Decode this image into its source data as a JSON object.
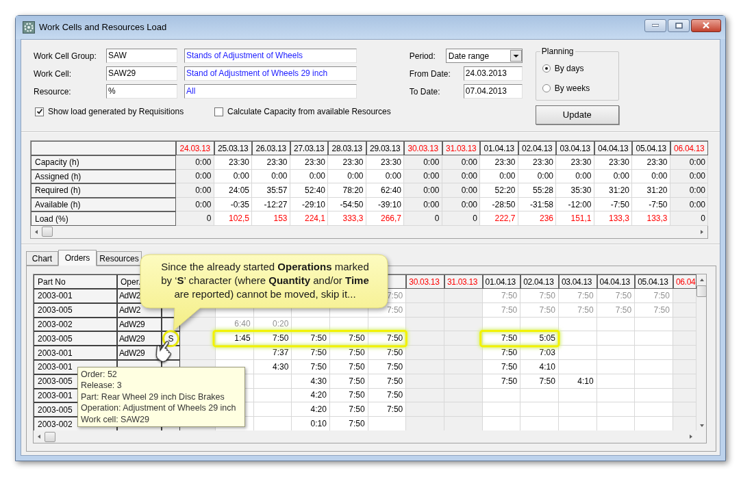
{
  "window": {
    "title": "Work Cells and Resources Load"
  },
  "filters": [
    {
      "label": "Work Cell Group:",
      "code": "SAW",
      "description": "Stands of Adjustment of Wheels"
    },
    {
      "label": "Work Cell:",
      "code": "SAW29",
      "description": "Stand of Adjustment of Wheels 29 inch"
    },
    {
      "label": "Resource:",
      "code": "%",
      "description": "All"
    }
  ],
  "options": [
    {
      "label": "Show load generated by Requisitions",
      "checked": true
    },
    {
      "label": "Calculate Capacity from available Resources",
      "checked": false
    }
  ],
  "period": {
    "label": "Period:",
    "value": "Date range"
  },
  "dates": [
    {
      "label": "From Date:",
      "value": "24.03.2013"
    },
    {
      "label": "To Date:",
      "value": "07.04.2013"
    }
  ],
  "planning": {
    "title": "Planning",
    "options": [
      {
        "label": "By days",
        "selected": true
      },
      {
        "label": "By weeks",
        "selected": false
      }
    ]
  },
  "update_button": "Update",
  "summary": {
    "columns": [
      {
        "label": "24.03.13",
        "weekend": true
      },
      {
        "label": "25.03.13",
        "weekend": false
      },
      {
        "label": "26.03.13",
        "weekend": false
      },
      {
        "label": "27.03.13",
        "weekend": false
      },
      {
        "label": "28.03.13",
        "weekend": false
      },
      {
        "label": "29.03.13",
        "weekend": false
      },
      {
        "label": "30.03.13",
        "weekend": true
      },
      {
        "label": "31.03.13",
        "weekend": true
      },
      {
        "label": "01.04.13",
        "weekend": false
      },
      {
        "label": "02.04.13",
        "weekend": false
      },
      {
        "label": "03.04.13",
        "weekend": false
      },
      {
        "label": "04.04.13",
        "weekend": false
      },
      {
        "label": "05.04.13",
        "weekend": false
      },
      {
        "label": "06.04.13",
        "weekend": true
      }
    ],
    "rows": [
      {
        "label": "Capacity (h)",
        "cells": [
          "0:00",
          "23:30",
          "23:30",
          "23:30",
          "23:30",
          "23:30",
          "0:00",
          "0:00",
          "23:30",
          "23:30",
          "23:30",
          "23:30",
          "23:30",
          "0:00"
        ]
      },
      {
        "label": "Assigned (h)",
        "cells": [
          "0:00",
          "0:00",
          "0:00",
          "0:00",
          "0:00",
          "0:00",
          "0:00",
          "0:00",
          "0:00",
          "0:00",
          "0:00",
          "0:00",
          "0:00",
          "0:00"
        ]
      },
      {
        "label": "Required (h)",
        "cells": [
          "0:00",
          "24:05",
          "35:57",
          "52:40",
          "78:20",
          "62:40",
          "0:00",
          "0:00",
          "52:20",
          "55:28",
          "35:30",
          "31:20",
          "31:20",
          "0:00"
        ]
      },
      {
        "label": "Available (h)",
        "cells": [
          "0:00",
          "-0:35",
          "-12:27",
          "-29:10",
          "-54:50",
          "-39:10",
          "0:00",
          "0:00",
          "-28:50",
          "-31:58",
          "-12:00",
          "-7:50",
          "-7:50",
          "0:00"
        ]
      },
      {
        "label": "Load (%)",
        "cells": [
          {
            "text": "0",
            "over": false
          },
          {
            "text": "102,5",
            "over": true
          },
          {
            "text": "153",
            "over": true
          },
          {
            "text": "224,1",
            "over": true
          },
          {
            "text": "333,3",
            "over": true
          },
          {
            "text": "266,7",
            "over": true
          },
          {
            "text": "0",
            "over": false
          },
          {
            "text": "0",
            "over": false
          },
          {
            "text": "222,7",
            "over": true
          },
          {
            "text": "236",
            "over": true
          },
          {
            "text": "151,1",
            "over": true
          },
          {
            "text": "133,3",
            "over": true
          },
          {
            "text": "133,3",
            "over": true
          },
          {
            "text": "0",
            "over": false
          }
        ]
      }
    ]
  },
  "tabs": [
    {
      "label": "Chart",
      "selected": false
    },
    {
      "label": "Orders",
      "selected": true
    },
    {
      "label": "Resources",
      "selected": false
    }
  ],
  "orders": {
    "columns": [
      "Part No",
      "Oper."
    ],
    "date_headers": [
      "30.03.13",
      "31.03.13",
      "01.04.13",
      "02.04.13",
      "03.04.13",
      "04.04.13",
      "05.04.13",
      "06.04"
    ],
    "rows": [
      {
        "part_no": "2003-001",
        "oper": "AdW2",
        "cells": [
          null,
          null,
          null,
          null,
          null,
          {
            "text": "7:50",
            "muted": true,
            "highlighted": false
          },
          null,
          null,
          {
            "text": "7:50",
            "muted": true,
            "highlighted": false
          },
          {
            "text": "7:50",
            "muted": true,
            "highlighted": false
          },
          {
            "text": "7:50",
            "muted": true,
            "highlighted": false
          },
          {
            "text": "7:50",
            "muted": true,
            "highlighted": false
          },
          {
            "text": "7:50",
            "muted": true,
            "highlighted": false
          },
          null
        ]
      },
      {
        "part_no": "2003-005",
        "oper": "AdW2",
        "cells": [
          null,
          null,
          null,
          null,
          null,
          {
            "text": "7:50",
            "muted": true,
            "highlighted": false
          },
          null,
          null,
          {
            "text": "7:50",
            "muted": true,
            "highlighted": false
          },
          {
            "text": "7:50",
            "muted": true,
            "highlighted": false
          },
          {
            "text": "7:50",
            "muted": true,
            "highlighted": false
          },
          {
            "text": "7:50",
            "muted": true,
            "highlighted": false
          },
          {
            "text": "7:50",
            "muted": true,
            "highlighted": false
          },
          null
        ]
      },
      {
        "part_no": "2003-002",
        "oper": "AdW29",
        "cells": [
          null,
          {
            "text": "6:40",
            "muted": true,
            "highlighted": false
          },
          {
            "text": "0:20",
            "muted": true,
            "highlighted": false
          },
          null,
          null,
          null,
          null,
          null,
          null,
          null,
          null,
          null,
          null,
          null
        ]
      },
      {
        "part_no": "2003-005",
        "oper": "AdW29",
        "status": "S",
        "cells": [
          null,
          {
            "text": "1:45",
            "muted": false,
            "highlighted": true
          },
          {
            "text": "7:50",
            "muted": false,
            "highlighted": true
          },
          {
            "text": "7:50",
            "muted": false,
            "highlighted": true
          },
          {
            "text": "7:50",
            "muted": false,
            "highlighted": true
          },
          {
            "text": "7:50",
            "muted": false,
            "highlighted": true
          },
          null,
          null,
          {
            "text": "7:50",
            "muted": false,
            "highlighted": true
          },
          {
            "text": "5:05",
            "muted": false,
            "highlighted": true
          },
          null,
          null,
          null,
          null
        ]
      },
      {
        "part_no": "2003-001",
        "oper": "AdW29",
        "cells": [
          null,
          null,
          {
            "text": "7:37",
            "muted": false,
            "highlighted": false
          },
          {
            "text": "7:50",
            "muted": false,
            "highlighted": false
          },
          {
            "text": "7:50",
            "muted": false,
            "highlighted": false
          },
          {
            "text": "7:50",
            "muted": false,
            "highlighted": false
          },
          null,
          null,
          {
            "text": "7:50",
            "muted": false,
            "highlighted": false
          },
          {
            "text": "7:03",
            "muted": false,
            "highlighted": false
          },
          null,
          null,
          null,
          null
        ]
      },
      {
        "part_no": "2003-001",
        "cells": [
          null,
          null,
          {
            "text": "4:30",
            "muted": false,
            "highlighted": false
          },
          {
            "text": "7:50",
            "muted": false,
            "highlighted": false
          },
          {
            "text": "7:50",
            "muted": false,
            "highlighted": false
          },
          {
            "text": "7:50",
            "muted": false,
            "highlighted": false
          },
          null,
          null,
          {
            "text": "7:50",
            "muted": false,
            "highlighted": false
          },
          {
            "text": "4:10",
            "muted": false,
            "highlighted": false
          },
          null,
          null,
          null,
          null
        ]
      },
      {
        "part_no": "2003-005",
        "cells": [
          null,
          null,
          null,
          {
            "text": "4:30",
            "muted": false,
            "highlighted": false
          },
          {
            "text": "7:50",
            "muted": false,
            "highlighted": false
          },
          {
            "text": "7:50",
            "muted": false,
            "highlighted": false
          },
          null,
          null,
          {
            "text": "7:50",
            "muted": false,
            "highlighted": false
          },
          {
            "text": "7:50",
            "muted": false,
            "highlighted": false
          },
          {
            "text": "4:10",
            "muted": false,
            "highlighted": false
          },
          null,
          null,
          null
        ]
      },
      {
        "part_no": "2003-001",
        "cells": [
          null,
          null,
          null,
          {
            "text": "4:20",
            "muted": false,
            "highlighted": false
          },
          {
            "text": "7:50",
            "muted": false,
            "highlighted": false
          },
          {
            "text": "7:50",
            "muted": false,
            "highlighted": false
          },
          null,
          null,
          null,
          null,
          null,
          null,
          null,
          null
        ]
      },
      {
        "part_no": "2003-005",
        "cells": [
          null,
          null,
          null,
          {
            "text": "4:20",
            "muted": false,
            "highlighted": false
          },
          {
            "text": "7:50",
            "muted": false,
            "highlighted": false
          },
          {
            "text": "7:50",
            "muted": false,
            "highlighted": false
          },
          null,
          null,
          null,
          null,
          null,
          null,
          null,
          null
        ]
      },
      {
        "part_no": "2003-002",
        "cells": [
          null,
          null,
          null,
          {
            "text": "0:10",
            "muted": false,
            "highlighted": false
          },
          {
            "text": "7:50",
            "muted": false,
            "highlighted": false
          },
          null,
          null,
          null,
          null,
          null,
          null,
          null,
          null,
          null
        ]
      }
    ]
  },
  "callout": "Since the already started **Operations** marked by ‘**S**’ character (where **Quantity** and/or **Time** are reported) cannot be moved, skip it...",
  "tooltip": {
    "lines": [
      "Order: 52",
      "Release: 3",
      "Part: Rear Wheel 29 inch Disc Brakes",
      "Operation: Adjustment of Wheels 29 inch",
      "Work cell: SAW29"
    ]
  }
}
